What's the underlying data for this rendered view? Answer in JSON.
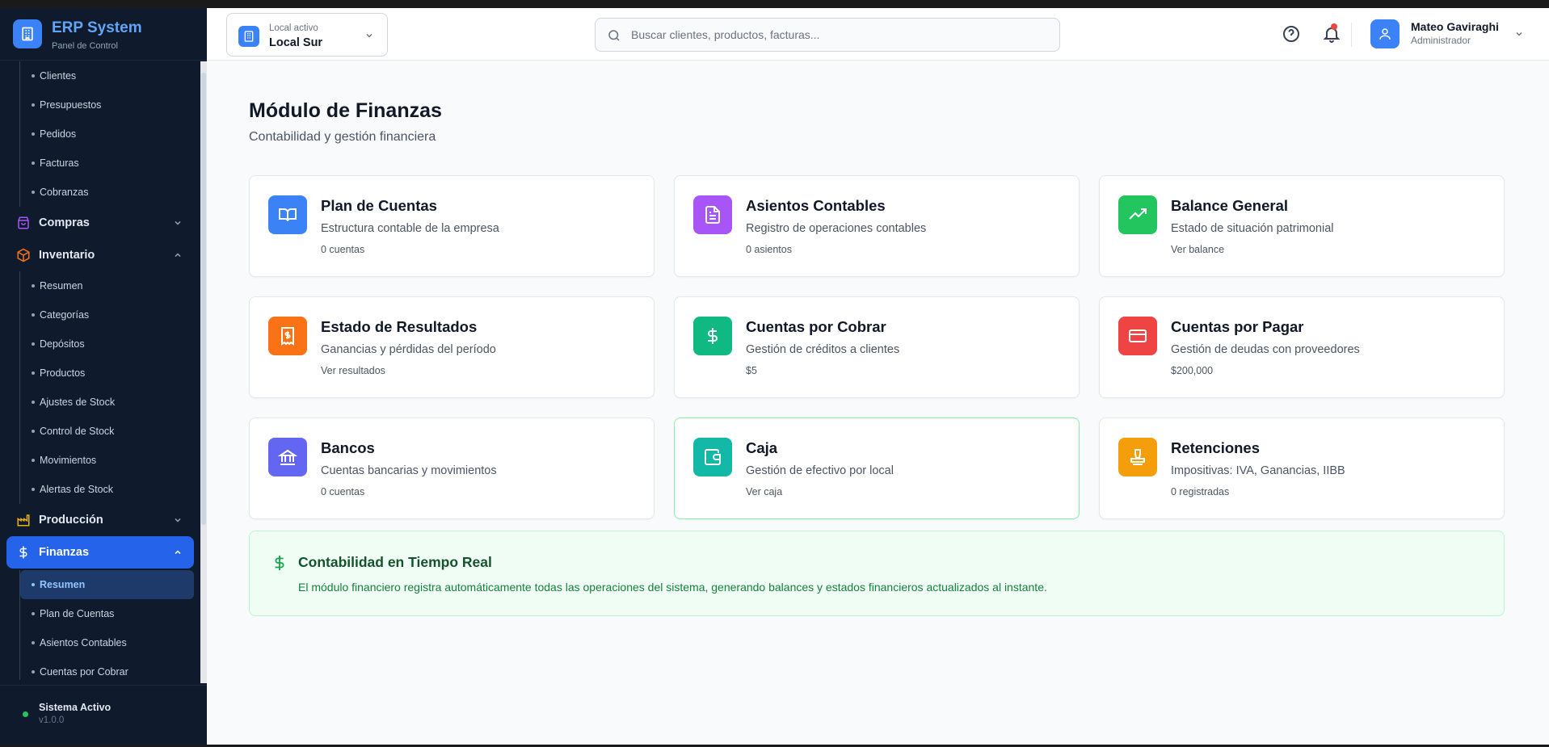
{
  "brand": {
    "title": "ERP System",
    "subtitle": "Panel de Control"
  },
  "sidebar": {
    "ventas_items": [
      "Clientes",
      "Presupuestos",
      "Pedidos",
      "Facturas",
      "Cobranzas"
    ],
    "compras": "Compras",
    "inventario": "Inventario",
    "inventario_items": [
      "Resumen",
      "Categorías",
      "Depósitos",
      "Productos",
      "Ajustes de Stock",
      "Control de Stock",
      "Movimientos",
      "Alertas de Stock"
    ],
    "produccion": "Producción",
    "finanzas": "Finanzas",
    "finanzas_items": [
      "Resumen",
      "Plan de Cuentas",
      "Asientos Contables",
      "Cuentas por Cobrar"
    ],
    "active_item": "Resumen"
  },
  "system": {
    "status": "Sistema Activo",
    "version": "v1.0.0"
  },
  "header": {
    "local_label": "Local activo",
    "local_value": "Local Sur",
    "search_placeholder": "Buscar clientes, productos, facturas...",
    "user_name": "Mateo Gaviraghi",
    "user_role": "Administrador"
  },
  "page": {
    "title": "Módulo de Finanzas",
    "subtitle": "Contabilidad y gestión financiera"
  },
  "cards": [
    {
      "title": "Plan de Cuentas",
      "desc": "Estructura contable de la empresa",
      "meta": "0 cuentas",
      "color": "#3b82f6",
      "icon": "book-icon"
    },
    {
      "title": "Asientos Contables",
      "desc": "Registro de operaciones contables",
      "meta": "0 asientos",
      "color": "#a855f7",
      "icon": "document-icon"
    },
    {
      "title": "Balance General",
      "desc": "Estado de situación patrimonial",
      "meta": "Ver balance",
      "color": "#22c55e",
      "icon": "trending-up-icon"
    },
    {
      "title": "Estado de Resultados",
      "desc": "Ganancias y pérdidas del período",
      "meta": "Ver resultados",
      "color": "#f97316",
      "icon": "receipt-icon"
    },
    {
      "title": "Cuentas por Cobrar",
      "desc": "Gestión de créditos a clientes",
      "meta": "$5",
      "color": "#10b981",
      "icon": "dollar-icon"
    },
    {
      "title": "Cuentas por Pagar",
      "desc": "Gestión de deudas con proveedores",
      "meta": "$200,000",
      "color": "#ef4444",
      "icon": "credit-card-icon"
    },
    {
      "title": "Bancos",
      "desc": "Cuentas bancarias y movimientos",
      "meta": "0 cuentas",
      "color": "#6366f1",
      "icon": "bank-icon"
    },
    {
      "title": "Caja",
      "desc": "Gestión de efectivo por local",
      "meta": "Ver caja",
      "color": "#14b8a6",
      "icon": "wallet-icon"
    },
    {
      "title": "Retenciones",
      "desc": "Impositivas: IVA, Ganancias, IIBB",
      "meta": "0 registradas",
      "color": "#f59e0b",
      "icon": "stamp-icon"
    }
  ],
  "banner": {
    "title": "Contabilidad en Tiempo Real",
    "text": "El módulo financiero registra automáticamente todas las operaciones del sistema, generando balances y estados financieros actualizados al instante."
  },
  "colors": {
    "accent": "#2563eb",
    "sidebar_bg": "#0f1b2d",
    "success": "#22c55e"
  }
}
